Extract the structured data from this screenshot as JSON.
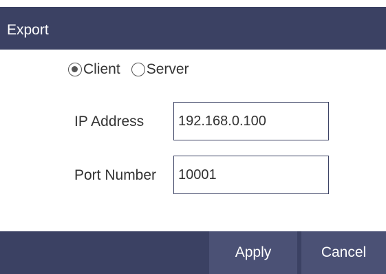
{
  "dialog": {
    "title": "Export"
  },
  "mode": {
    "options": [
      {
        "label": "Client",
        "checked": true
      },
      {
        "label": "Server",
        "checked": false
      }
    ]
  },
  "fields": {
    "ip_label": "IP Address",
    "ip_value": "192.168.0.100",
    "port_label": "Port Number",
    "port_value": "10001"
  },
  "footer": {
    "apply_label": "Apply",
    "cancel_label": "Cancel"
  },
  "colors": {
    "header_bg": "#3b4163",
    "button_bg": "#4b5175",
    "text": "#333333"
  }
}
